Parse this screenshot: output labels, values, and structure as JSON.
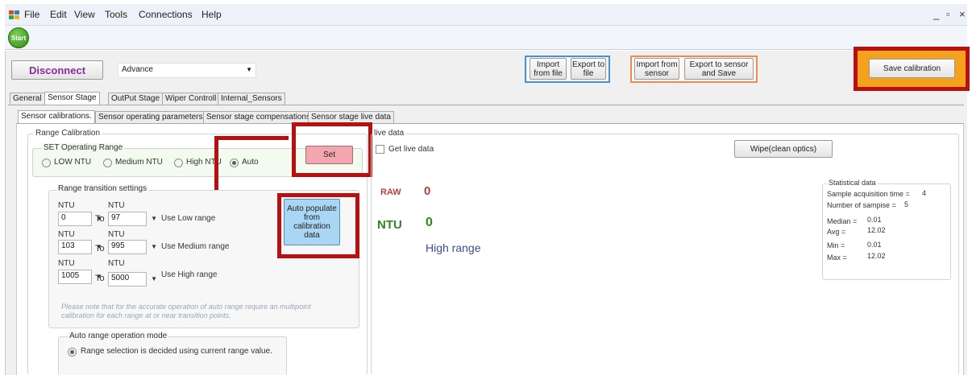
{
  "menu": {
    "items": [
      "File",
      "Edit",
      "View",
      "Tools",
      "Connections",
      "Help"
    ],
    "window_controls": [
      "_",
      "▫",
      "×"
    ]
  },
  "toolbar": {
    "start_label": "Start"
  },
  "top": {
    "disconnect_label": "Disconnect",
    "mode_value": "Advance",
    "import_file_label": "Import from file",
    "export_file_label": "Export to file",
    "import_sensor_label": "Import from sensor",
    "export_sensor_label": "Export to sensor and Save",
    "save_calibration_label": "Save calibration"
  },
  "main_tabs": [
    "General",
    "Sensor Stage",
    "OutPut Stage",
    "Wiper Controll",
    "Internal_Sensors"
  ],
  "sub_tabs": [
    "Sensor calibrations.",
    "Sensor operating parameters",
    "Sensor stage compensations",
    "Sensor stage live data"
  ],
  "range_calibration": {
    "title": "Range Calibration",
    "operating_range_title": "SET Operating Range",
    "options": [
      "LOW NTU",
      "Medium NTU",
      "High NTU",
      "Auto"
    ],
    "set_label": "Set",
    "transition_title": "Range transition settings",
    "col_label": "NTU",
    "to_label": "To",
    "rows": [
      {
        "from": "0",
        "to": "97",
        "use": "Use Low range"
      },
      {
        "from": "103",
        "to": "995",
        "use": "Use Medium range"
      },
      {
        "from": "1005",
        "to": "5000",
        "use": "Use High range"
      }
    ],
    "auto_populate_label": "Auto populate from calibration data",
    "note": "Please note that for the accurate operation of auto range require an multipoint calibration for each range at or near transition points.",
    "auto_mode_title": "Auto range operation mode",
    "auto_mode_option": "Range selection is decided using current range value."
  },
  "live": {
    "title": "live data",
    "get_live_label": "Get live data",
    "wipe_label": "Wipe(clean optics)",
    "raw_label": "RAW",
    "raw_value": "0",
    "ntu_label": "NTU",
    "ntu_value": "0",
    "range_text": "High range"
  },
  "stats": {
    "title": "Statistical data",
    "sample_time_label": "Sample acquisition time =",
    "sample_time_value": "4",
    "num_samples_label": "Number of sampise =",
    "num_samples_value": "5",
    "median_label": "Median =",
    "median_value": "0.01",
    "avg_label": "Avg =",
    "avg_value": "12.02",
    "min_label": "Min =",
    "min_value": "0.01",
    "max_label": "Max =",
    "max_value": "12.02"
  },
  "colors": {
    "highlight_red": "#b80f10",
    "save_orange": "#f4a21c",
    "set_button_pink": "#f4a6ae",
    "auto_populate_blue": "#a9d6f5",
    "raw_red": "#b84040",
    "ntu_green": "#2e8a1e",
    "range_blue": "#3a4e8c"
  }
}
